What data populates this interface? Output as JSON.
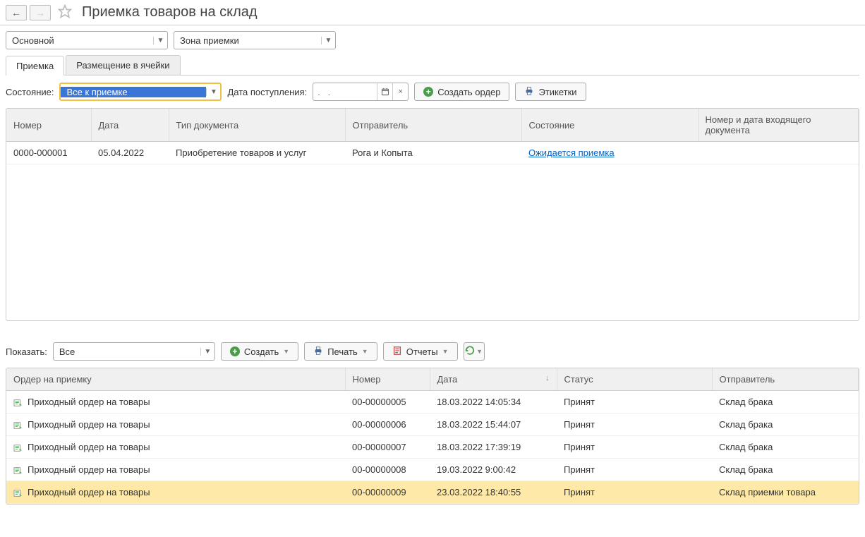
{
  "page_title": "Приемка товаров на склад",
  "filter1": {
    "value": "Основной"
  },
  "filter2": {
    "value": "Зона приемки"
  },
  "tabs": {
    "t1": "Приемка",
    "t2": "Размещение в ячейки"
  },
  "state_label": "Состояние:",
  "state_value": "Все к приемке",
  "date_label": "Дата поступления:",
  "date_placeholder": ".   .",
  "btn_create_order": "Создать ордер",
  "btn_labels": "Этикетки",
  "top_table": {
    "cols": {
      "number": "Номер",
      "date": "Дата",
      "doctype": "Тип документа",
      "sender": "Отправитель",
      "state": "Состояние",
      "incoming": "Номер и дата входящего документа"
    },
    "rows": [
      {
        "number": "0000-000001",
        "date": "05.04.2022",
        "doctype": "Приобретение товаров и услуг",
        "sender": "Рога и Копыта",
        "state": "Ожидается приемка",
        "incoming": ""
      }
    ]
  },
  "show_label": "Показать:",
  "show_value": "Все",
  "btn_create": "Создать",
  "btn_print": "Печать",
  "btn_reports": "Отчеты",
  "bottom_table": {
    "cols": {
      "order": "Ордер на приемку",
      "number": "Номер",
      "date": "Дата",
      "status": "Статус",
      "sender": "Отправитель"
    },
    "rows": [
      {
        "order": "Приходный ордер на товары",
        "number": "00-00000005",
        "date": "18.03.2022 14:05:34",
        "status": "Принят",
        "sender": "Склад брака"
      },
      {
        "order": "Приходный ордер на товары",
        "number": "00-00000006",
        "date": "18.03.2022 15:44:07",
        "status": "Принят",
        "sender": "Склад брака"
      },
      {
        "order": "Приходный ордер на товары",
        "number": "00-00000007",
        "date": "18.03.2022 17:39:19",
        "status": "Принят",
        "sender": "Склад брака"
      },
      {
        "order": "Приходный ордер на товары",
        "number": "00-00000008",
        "date": "19.03.2022 9:00:42",
        "status": "Принят",
        "sender": "Склад брака"
      },
      {
        "order": "Приходный ордер на товары",
        "number": "00-00000009",
        "date": "23.03.2022 18:40:55",
        "status": "Принят",
        "sender": "Склад приемки товара"
      }
    ]
  }
}
